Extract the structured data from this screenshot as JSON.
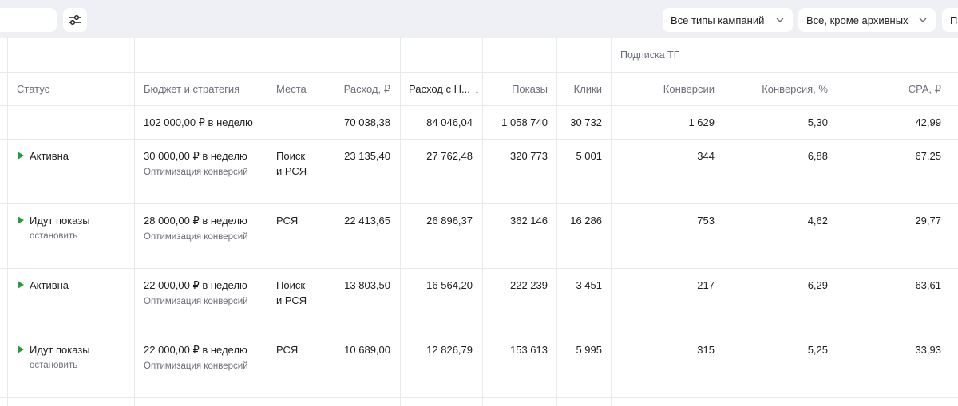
{
  "toolbar": {
    "filters": {
      "campaign_types": "Все типы кампаний",
      "archive": "Все, кроме архивных",
      "third": "По"
    }
  },
  "table": {
    "group_label": "Подписка ТГ",
    "headers": {
      "status": "Статус",
      "budget": "Бюджет и стратегия",
      "places": "Места",
      "spend": "Расход, ₽",
      "spend_vat": "Расход с Н...",
      "sort_indicator": "↓",
      "impressions": "Показы",
      "clicks": "Клики",
      "conversions": "Конверсии",
      "conv_rate": "Конверсия, %",
      "cpa": "CPA, ₽"
    },
    "totals": {
      "budget": "102 000,00 ₽ в неделю",
      "spend": "70 038,38",
      "spend_vat": "84 046,04",
      "impressions": "1 058 740",
      "clicks": "30 732",
      "conversions": "1 629",
      "conv_rate": "5,30",
      "cpa": "42,99"
    },
    "rows": [
      {
        "status": "Активна",
        "status_action": "",
        "budget": "30 000,00 ₽ в неделю",
        "strategy": "Оптимизация конверсий",
        "places_line1": "Поиск",
        "places_line2": "и РСЯ",
        "spend": "23 135,40",
        "spend_vat": "27 762,48",
        "impressions": "320 773",
        "clicks": "5 001",
        "conversions": "344",
        "conv_rate": "6,88",
        "cpa": "67,25"
      },
      {
        "status": "Идут показы",
        "status_action": "остановить",
        "budget": "28 000,00 ₽ в неделю",
        "strategy": "Оптимизация конверсий",
        "places_line1": "РСЯ",
        "places_line2": "",
        "spend": "22 413,65",
        "spend_vat": "26 896,37",
        "impressions": "362 146",
        "clicks": "16 286",
        "conversions": "753",
        "conv_rate": "4,62",
        "cpa": "29,77"
      },
      {
        "status": "Активна",
        "status_action": "",
        "budget": "22 000,00 ₽ в неделю",
        "strategy": "Оптимизация конверсий",
        "places_line1": "Поиск",
        "places_line2": "и РСЯ",
        "spend": "13 803,50",
        "spend_vat": "16 564,20",
        "impressions": "222 239",
        "clicks": "3 451",
        "conversions": "217",
        "conv_rate": "6,29",
        "cpa": "63,61"
      },
      {
        "status": "Идут показы",
        "status_action": "остановить",
        "budget": "22 000,00 ₽ в неделю",
        "strategy": "Оптимизация конверсий",
        "places_line1": "РСЯ",
        "places_line2": "",
        "spend": "10 689,00",
        "spend_vat": "12 826,79",
        "impressions": "153 613",
        "clicks": "5 995",
        "conversions": "315",
        "conv_rate": "5,25",
        "cpa": "33,93"
      }
    ]
  }
}
